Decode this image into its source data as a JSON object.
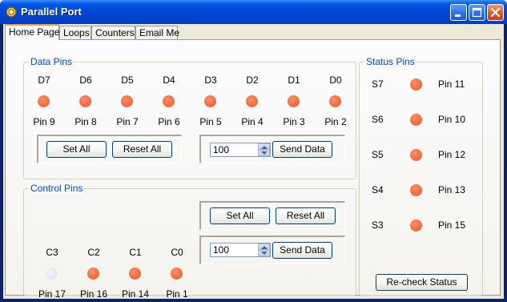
{
  "window": {
    "title": "Parallel Port"
  },
  "tabs": [
    "Home Page",
    "Loops",
    "Counters",
    "Email Me"
  ],
  "data_pins": {
    "label": "Data Pins",
    "names": [
      "D7",
      "D6",
      "D5",
      "D4",
      "D3",
      "D2",
      "D1",
      "D0"
    ],
    "pins": [
      "Pin 9",
      "Pin 8",
      "Pin 7",
      "Pin 6",
      "Pin 5",
      "Pin 4",
      "Pin 3",
      "Pin 2"
    ],
    "states": [
      true,
      true,
      true,
      true,
      true,
      true,
      true,
      true
    ],
    "set_all": "Set All",
    "reset_all": "Reset All",
    "value": "100",
    "send": "Send Data"
  },
  "control_pins": {
    "label": "Control Pins",
    "names": [
      "C3",
      "C2",
      "C1",
      "C0"
    ],
    "pins": [
      "Pin 17",
      "Pin 16",
      "Pin 14",
      "Pin 1"
    ],
    "states": [
      false,
      true,
      true,
      true
    ],
    "set_all": "Set All",
    "reset_all": "Reset All",
    "value": "100",
    "send": "Send Data"
  },
  "status_pins": {
    "label": "Status Pins",
    "names": [
      "S7",
      "S6",
      "S5",
      "S4",
      "S3"
    ],
    "pins": [
      "Pin 11",
      "Pin 10",
      "Pin 12",
      "Pin 13",
      "Pin 15"
    ],
    "states": [
      true,
      true,
      true,
      true,
      true
    ],
    "recheck": "Re-check Status"
  },
  "colors": {
    "led_on": "#f26b3e",
    "led_off": "#e3e5f4",
    "group_label": "#0046d5"
  }
}
